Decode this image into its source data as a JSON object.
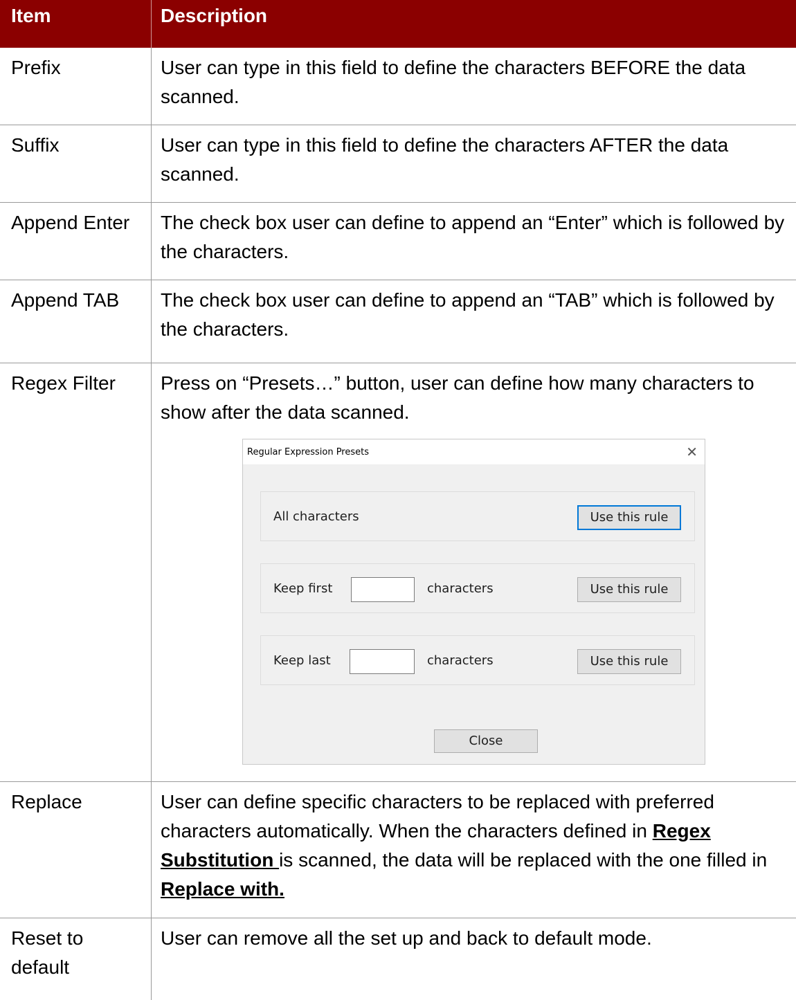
{
  "table": {
    "headers": {
      "item": "Item",
      "description": "Description"
    },
    "rows": [
      {
        "item": "Prefix",
        "desc": "User can type in this field to define the characters BEFORE the data scanned."
      },
      {
        "item": "Suffix",
        "desc": "User can type in this field to define the characters AFTER the data scanned."
      },
      {
        "item": "Append Enter",
        "desc": "The check box user can define to append an “Enter” which is followed by the characters."
      },
      {
        "item": "Append TAB",
        "desc": "The check box user can define to append an “TAB” which is followed by the characters."
      },
      {
        "item": "Regex Filter",
        "desc": "Press on “Presets…” button, user can define how many characters to show after the data scanned."
      },
      {
        "item": "Replace",
        "desc_part1": "User can define specific characters to be replaced with preferred characters automatically. When the characters defined in ",
        "desc_bold1": "Regex Substitution ",
        "desc_part2": "is scanned, the data will be replaced with the one filled in ",
        "desc_bold2": "Replace with."
      },
      {
        "item": "Reset to default",
        "desc": "User can remove all the set up and back to default mode."
      }
    ]
  },
  "dialog": {
    "title": "Regular Expression Presets",
    "close_glyph": "✕",
    "rule_all_label": "All characters",
    "rule_first_label": "Keep first",
    "rule_last_label": "Keep last",
    "characters_label": "characters",
    "use_rule_label": "Use this rule",
    "first_value": "",
    "last_value": "",
    "close_button_label": "Close"
  },
  "colors": {
    "header_bg": "#8B0000",
    "header_text": "#ffffff",
    "grid": "#999999",
    "focus": "#0078d7"
  }
}
